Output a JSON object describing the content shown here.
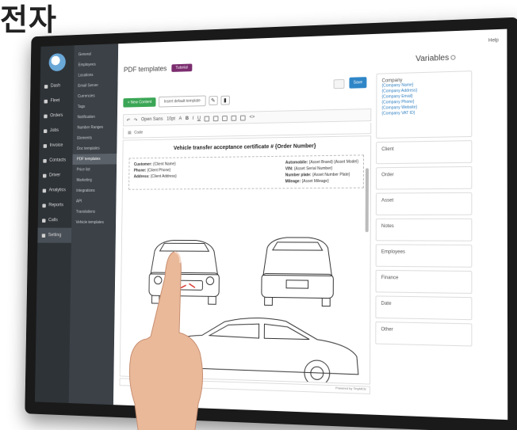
{
  "headline": "전자",
  "topbar": {
    "user": "Help"
  },
  "nav": [
    {
      "label": "Dash",
      "icon": "dashboard-icon"
    },
    {
      "label": "Fleet",
      "icon": "car-icon"
    },
    {
      "label": "Orders",
      "icon": "orders-icon"
    },
    {
      "label": "Jobs",
      "icon": "jobs-icon"
    },
    {
      "label": "Invoice",
      "icon": "invoice-icon"
    },
    {
      "label": "Contacts",
      "icon": "contacts-icon"
    },
    {
      "label": "Driver",
      "icon": "driver-icon"
    },
    {
      "label": "Analytics",
      "icon": "analytics-icon"
    },
    {
      "label": "Reports",
      "icon": "reports-icon"
    },
    {
      "label": "Calls",
      "icon": "calls-icon"
    },
    {
      "label": "Setting",
      "icon": "settings-icon",
      "active": true
    }
  ],
  "subnav": [
    "General",
    "Employees",
    "Locations",
    "Email Server",
    "Currencies",
    "Tags",
    "Notification",
    "Number Ranges",
    "Elements",
    "Doc templates",
    "PDF templates",
    "Price list",
    "Marketing",
    "Integrations",
    "API",
    "Translations",
    "Vehicle templates"
  ],
  "subnav_active_index": 10,
  "page": {
    "title": "PDF templates",
    "badge": "Tutorial"
  },
  "buttons": {
    "save": "Save",
    "add": "+ New Content",
    "insert": "Insert default template"
  },
  "editor": {
    "font": "Open Sans",
    "size": "10pt",
    "format_label": "Code",
    "doc_title": "Vehicle transfer acceptance certificate # {Order Number}",
    "fields_left": [
      {
        "k": "Customer:",
        "v": "{Client Name}"
      },
      {
        "k": "Phone:",
        "v": "{Client Phone}"
      },
      {
        "k": "Address:",
        "v": "{Client Address}"
      }
    ],
    "fields_right": [
      {
        "k": "Automobile:",
        "v": "{Asset Brand} {Asset Model}"
      },
      {
        "k": "VIN:",
        "v": "{Asset Serial Number}"
      },
      {
        "k": "Number plate:",
        "v": "{Asset Number Plate}"
      },
      {
        "k": "Mileage:",
        "v": "{Asset Mileage}"
      }
    ],
    "status": "Powered by TinyMCE"
  },
  "variables": {
    "title": "Variables",
    "company": {
      "label": "Company",
      "links": [
        "{Company Name}",
        "{Company Address}",
        "{Company Email}",
        "{Company Phone}",
        "{Company Website}",
        "{Company VAT ID}"
      ]
    },
    "groups": [
      "Client",
      "Order",
      "Asset",
      "Notes",
      "Employees",
      "Finance",
      "Date",
      "Other"
    ]
  }
}
